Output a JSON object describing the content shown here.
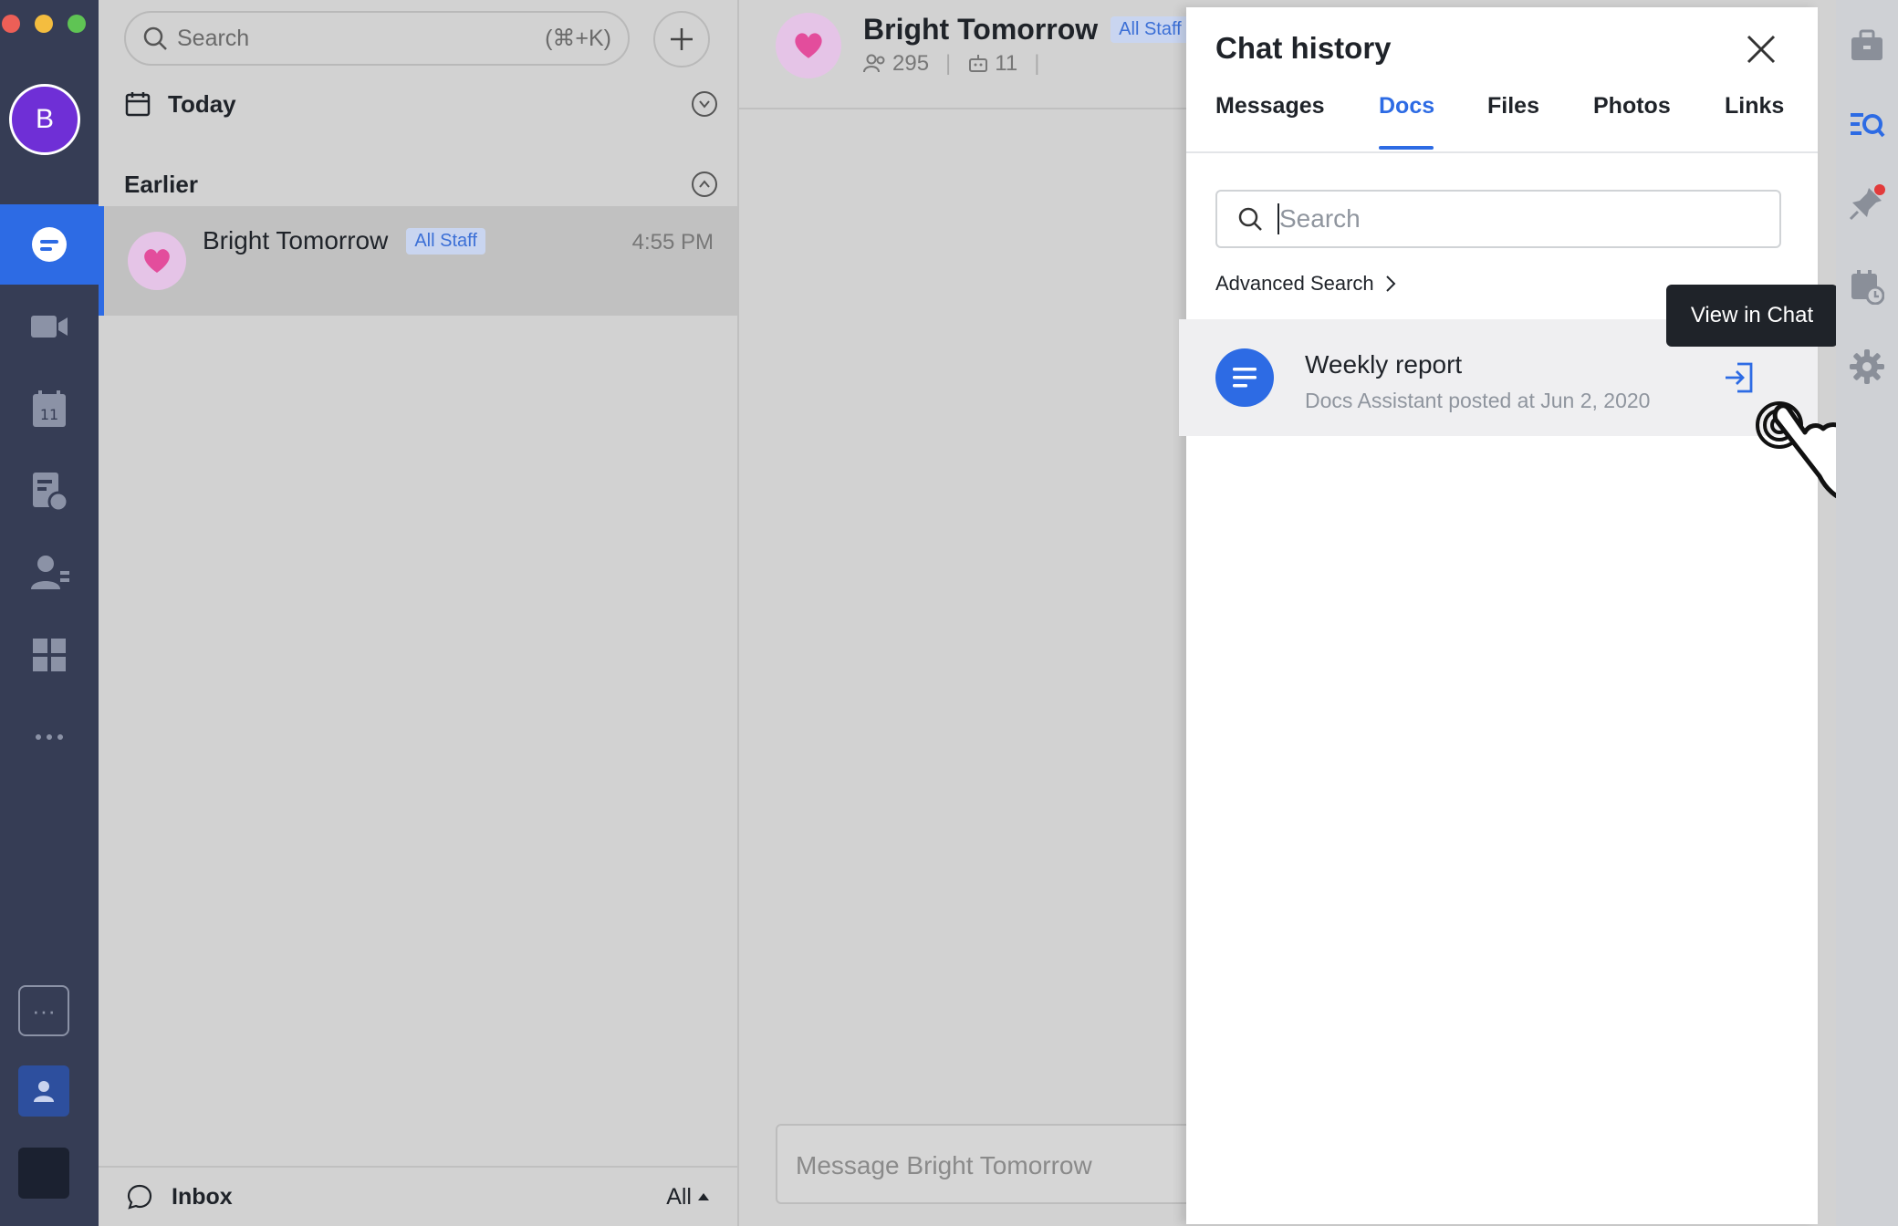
{
  "rail": {
    "avatar_letter": "B",
    "colors": {
      "bg": "#363d55",
      "active": "#2d6be4",
      "avatar": "#6f2fd6"
    }
  },
  "list": {
    "search_placeholder": "Search",
    "search_shortcut": "(⌘+K)",
    "today_label": "Today",
    "earlier_label": "Earlier",
    "conversation": {
      "name": "Bright Tomorrow",
      "tag": "All Staff",
      "time": "4:55 PM"
    },
    "footer_label": "Inbox",
    "footer_filter": "All"
  },
  "chat": {
    "title": "Bright Tomorrow",
    "tag": "All Staff",
    "members": "295",
    "bots": "11",
    "message_placeholder": "Message Bright Tomorrow"
  },
  "panel": {
    "title": "Chat history",
    "tabs": [
      "Messages",
      "Docs",
      "Files",
      "Photos",
      "Links"
    ],
    "active_tab": "Docs",
    "search_placeholder": "Search",
    "advanced_search": "Advanced Search",
    "doc": {
      "title": "Weekly report",
      "meta": "Docs Assistant posted at  Jun 2, 2020"
    },
    "tooltip": "View in Chat"
  },
  "icons": [
    "search-icon",
    "plus-icon",
    "calendar-icon",
    "chat-icon",
    "video-icon",
    "calendar-11-icon",
    "docs-icon",
    "contacts-icon",
    "apps-icon",
    "more-icon",
    "briefcase-icon",
    "history-search-icon",
    "pin-icon",
    "schedule-icon",
    "gear-icon",
    "close-icon",
    "doc-icon",
    "jump-to-chat-icon",
    "hand-cursor-icon"
  ]
}
